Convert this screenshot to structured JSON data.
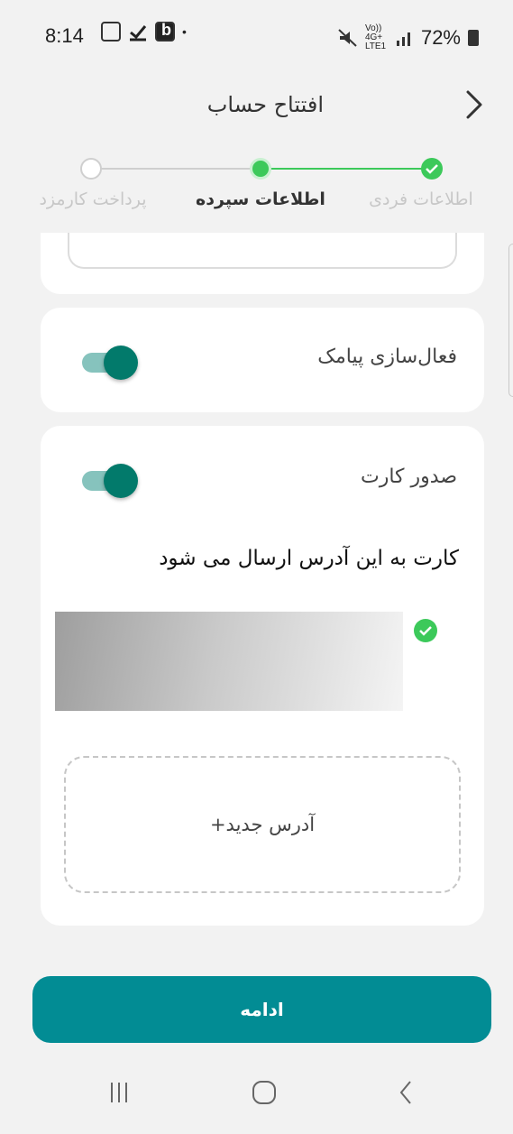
{
  "status_bar": {
    "time": "8:14",
    "network_label": "Vo)) 4G+ LTE1",
    "battery": "72%"
  },
  "header": {
    "title": "افتتاح حساب"
  },
  "stepper": {
    "steps": [
      {
        "label": "اطلاعات فردی",
        "state": "done"
      },
      {
        "label": "اطلاعات سپرده",
        "state": "current"
      },
      {
        "label": "پرداخت کارمزد",
        "state": "pending"
      }
    ],
    "colors": {
      "active": "#3cc95a",
      "inactive": "#cfcfcf"
    }
  },
  "sms": {
    "label": "فعال‌سازی پیامک",
    "enabled": true
  },
  "card_issue": {
    "label": "صدور کارت",
    "enabled": true,
    "send_text": "کارت به این آدرس ارسال می شود",
    "address_selected": true,
    "new_address_label": "+آدرس جدید"
  },
  "footer": {
    "continue_label": "ادامه"
  },
  "colors": {
    "accent": "#028c94",
    "toggle": "#027a6b",
    "success": "#3cc95a"
  }
}
